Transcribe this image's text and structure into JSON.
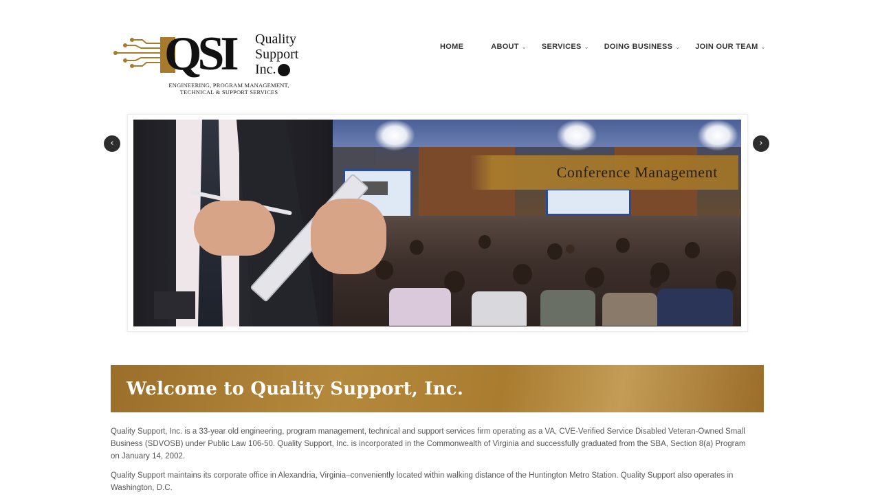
{
  "logo": {
    "mark": "QSI",
    "name_line1": "Quality",
    "name_line2": "Support",
    "name_line3": "Inc.",
    "tagline_line1": "Engineering, Program Management,",
    "tagline_line2": "Technical & Support Services"
  },
  "nav": {
    "items": [
      {
        "label": "HOME",
        "has_dropdown": false
      },
      {
        "label": "ABOUT",
        "has_dropdown": true
      },
      {
        "label": "SERVICES",
        "has_dropdown": true
      },
      {
        "label": "DOING BUSINESS",
        "has_dropdown": true
      },
      {
        "label": "JOIN OUR TEAM",
        "has_dropdown": true
      }
    ],
    "dropdown_glyph": "⌄"
  },
  "slider": {
    "caption": "Conference Management",
    "prev_glyph": "‹",
    "next_glyph": "›",
    "caption_color": "#a0732a"
  },
  "welcome": {
    "heading": "Welcome to Quality Support, Inc."
  },
  "content": {
    "paragraph1": "Quality Support, Inc. is a 33-year old engineering, program management, technical and support services firm operating as a VA, CVE-Verified Service Disabled Veteran-Owned Small Business (SDVOSB) under Public Law 106-50. Quality Support, Inc. is incorporated in the Commonwealth of Virginia and successfully graduated from the SBA, Section 8(a) Program on January 14, 2002.",
    "paragraph2": "Quality Support maintains its corporate office in Alexandria, Virginia–conveniently located within walking distance of the Huntington Metro Station. Quality Support also operates in Washington, D.C."
  },
  "colors": {
    "brand_gold": "#a97c30",
    "nav_text": "#333333",
    "body_text": "#555555"
  }
}
